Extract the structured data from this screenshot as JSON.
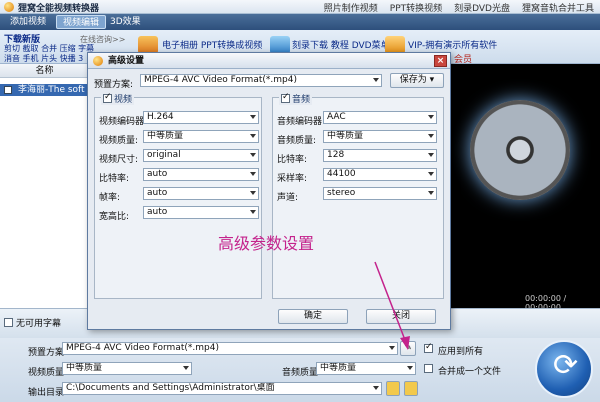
{
  "app": {
    "title": "狸窝全能视频转换器",
    "links": [
      "照片制作视频",
      "PPT转换视频",
      "刻录DVD光盘",
      "狸窝音轨合并工具"
    ]
  },
  "toolbar": {
    "tabs": [
      "添加视频",
      "视频编辑",
      "3D效果"
    ]
  },
  "banner": {
    "download": "下载新版",
    "online": "在线咨询>>",
    "tools_line1": "剪切 截取 合并 压缩 字幕",
    "tools_line2": "消音 手机 片头 快播 3",
    "link1": "电子相册 PPT转换成视频",
    "link2": "刻录下载 教程 DVD菜单",
    "link3": "VIP-拥有演示所有软件",
    "link3_sub": "会员"
  },
  "list": {
    "header": "名称",
    "file": "李海丽-The soft"
  },
  "preview": {
    "time": "00:00:00 / 00:00:00"
  },
  "subtitle": {
    "label": "无可用字幕"
  },
  "bottom": {
    "preset_label": "预置方案:",
    "preset_value": "MPEG-4 AVC Video Format(*.mp4)",
    "apply_all": "应用到所有",
    "video_quality_label": "视频质量:",
    "video_quality_value": "中等质量",
    "audio_quality_label": "音频质量:",
    "audio_quality_value": "中等质量",
    "merge": "合并成一个文件",
    "output_label": "输出目录:",
    "output_value": "C:\\Documents and Settings\\Administrator\\桌面"
  },
  "dialog": {
    "title": "高级设置",
    "preset_label": "预置方案:",
    "preset_value": "MPEG-4 AVC Video Format(*.mp4)",
    "save_as": "保存为",
    "video": {
      "title": "视频",
      "rows": [
        {
          "label": "视频编码器:",
          "value": "H.264"
        },
        {
          "label": "视频质量:",
          "value": "中等质量"
        },
        {
          "label": "视频尺寸:",
          "value": "original"
        },
        {
          "label": "比特率:",
          "value": "auto"
        },
        {
          "label": "帧率:",
          "value": "auto"
        },
        {
          "label": "宽高比:",
          "value": "auto"
        }
      ]
    },
    "audio": {
      "title": "音频",
      "rows": [
        {
          "label": "音频编码器:",
          "value": "AAC"
        },
        {
          "label": "音频质量:",
          "value": "中等质量"
        },
        {
          "label": "比特率:",
          "value": "128"
        },
        {
          "label": "采样率:",
          "value": "44100"
        },
        {
          "label": "声道:",
          "value": "stereo"
        }
      ]
    },
    "ok": "确定",
    "close": "关闭"
  },
  "annotation": "高级参数设置",
  "colors": {
    "accent": "#2d4f7c",
    "annotation": "#c4238c",
    "selection": "#3568b0"
  }
}
